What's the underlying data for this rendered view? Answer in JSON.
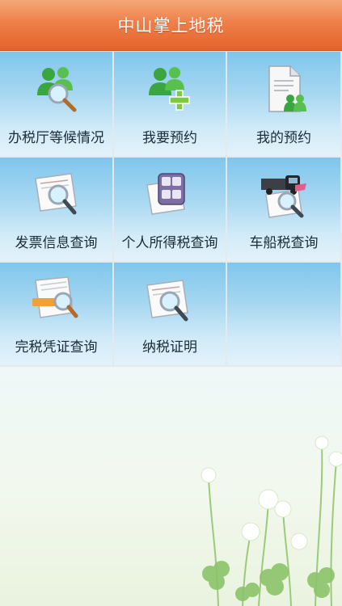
{
  "header": {
    "title": "中山掌上地税"
  },
  "menu": [
    {
      "label": "办税厅等候情况",
      "icon": "people-search-icon"
    },
    {
      "label": "我要预约",
      "icon": "people-add-icon"
    },
    {
      "label": "我的预约",
      "icon": "document-people-icon"
    },
    {
      "label": "发票信息查询",
      "icon": "invoice-search-icon"
    },
    {
      "label": "个人所得税查询",
      "icon": "calculator-icon"
    },
    {
      "label": "车船税查询",
      "icon": "truck-search-icon"
    },
    {
      "label": "完税凭证查询",
      "icon": "tax-receipt-search-icon"
    },
    {
      "label": "纳税证明",
      "icon": "certificate-search-icon"
    }
  ],
  "colors": {
    "header": "#ee7f49",
    "tile_top": "#7fc6ec",
    "tile_bottom": "#e3f2fa"
  }
}
